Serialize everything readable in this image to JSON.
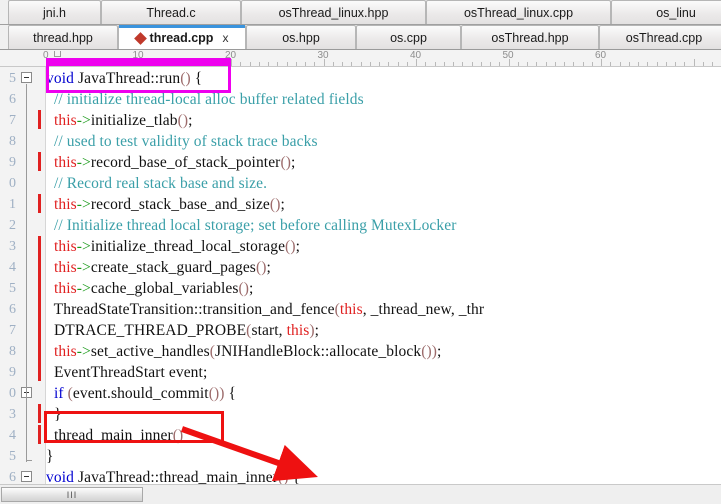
{
  "tabs_row1": [
    {
      "label": "jni.h",
      "active": false
    },
    {
      "label": "Thread.c",
      "active": false
    },
    {
      "label": "osThread_linux.hpp",
      "active": false
    },
    {
      "label": "osThread_linux.cpp",
      "active": false
    },
    {
      "label": "os_linu",
      "active": false
    }
  ],
  "tabs_row2": [
    {
      "label": "thread.hpp",
      "active": false
    },
    {
      "label": "thread.cpp",
      "active": true,
      "close": "x",
      "marker": "modified-diamond"
    },
    {
      "label": "os.hpp",
      "active": false
    },
    {
      "label": "os.cpp",
      "active": false
    },
    {
      "label": "osThread.hpp",
      "active": false
    },
    {
      "label": "osThread.cpp",
      "active": false
    }
  ],
  "ruler": {
    "labels": [
      "0",
      "10",
      "20",
      "30",
      "40",
      "50",
      "60"
    ],
    "caret_column": "0"
  },
  "gutter": {
    "line_numbers": [
      "5",
      "6",
      "7",
      "8",
      "9",
      "0",
      "1",
      "2",
      "3",
      "4",
      "5",
      "6",
      "7",
      "8",
      "9",
      "0",
      "3",
      "4",
      "5",
      "6"
    ]
  },
  "code_lines": [
    {
      "n": 0,
      "text": "void JavaThread::run() {"
    },
    {
      "n": 1,
      "text": "  // initialize thread-local alloc buffer related fields"
    },
    {
      "n": 2,
      "text": "  this->initialize_tlab();"
    },
    {
      "n": 3,
      "text": "  // used to test validity of stack trace backs"
    },
    {
      "n": 4,
      "text": "  this->record_base_of_stack_pointer();"
    },
    {
      "n": 5,
      "text": "  // Record real stack base and size."
    },
    {
      "n": 6,
      "text": "  this->record_stack_base_and_size();"
    },
    {
      "n": 7,
      "text": "  // Initialize thread local storage; set before calling MutexLocker"
    },
    {
      "n": 8,
      "text": "  this->initialize_thread_local_storage();"
    },
    {
      "n": 9,
      "text": "  this->create_stack_guard_pages();"
    },
    {
      "n": 10,
      "text": "  this->cache_global_variables();"
    },
    {
      "n": 11,
      "text": "  ThreadStateTransition::transition_and_fence(this, _thread_new, _thr"
    },
    {
      "n": 12,
      "text": "  DTRACE_THREAD_PROBE(start, this);"
    },
    {
      "n": 13,
      "text": "  this->set_active_handles(JNIHandleBlock::allocate_block());"
    },
    {
      "n": 14,
      "text": "  EventThreadStart event;"
    },
    {
      "n": 15,
      "text": "  if (event.should_commit()) {"
    },
    {
      "n": 16,
      "text": "  }"
    },
    {
      "n": 17,
      "text": "  thread_main_inner()"
    },
    {
      "n": 18,
      "text": "}"
    },
    {
      "n": 19,
      "text": "void JavaThread::thread_main_inner() {"
    }
  ],
  "annotations": {
    "magenta_box_label": "JavaThread::run()",
    "magenta_ruler_span_label": "columns 5 to 23 highlighted",
    "red_box_label": "thread_main_inner()",
    "red_arrow_label": "points to JavaThread::thread_main_inner definition"
  },
  "scrollbar": {
    "grip": "III"
  },
  "colors": {
    "keyword": "#0000d0",
    "comment": "#3a9fa8",
    "this_keyword": "#e02020",
    "paren": "#9c6b6b",
    "annotation_magenta": "#ee00ee",
    "annotation_red": "#ee1111",
    "active_tab_underline": "#3a93dd",
    "modified_marker": "#c0392b"
  }
}
